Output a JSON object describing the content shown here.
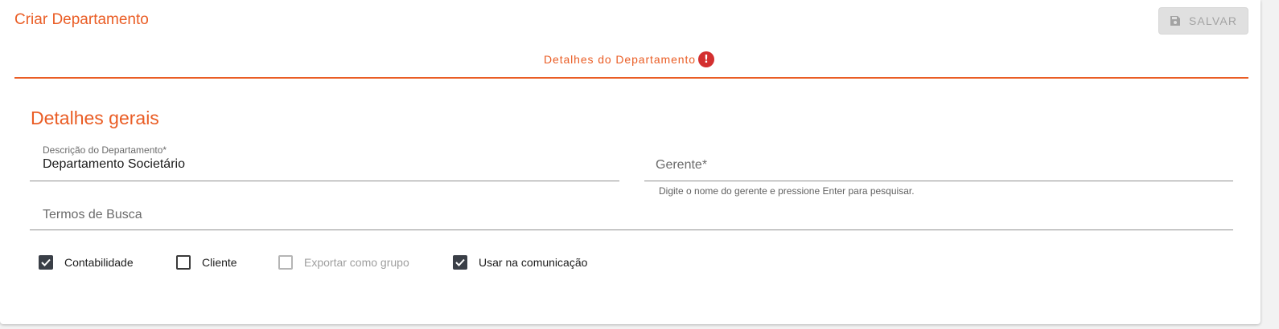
{
  "header": {
    "title": "Criar Departamento",
    "save_label": "SALVAR",
    "save_icon": "save-icon",
    "save_disabled": true
  },
  "tabs": [
    {
      "label": "Detalhes do Departamento",
      "active": true,
      "status_icon": "error-icon",
      "status_glyph": "!"
    }
  ],
  "form": {
    "section_title": "Detalhes gerais",
    "description": {
      "label": "Descrição do Departamento*",
      "value": "Departamento Societário"
    },
    "manager": {
      "label": "Gerente*",
      "value": "",
      "hint": "Digite o nome do gerente e pressione Enter para pesquisar."
    },
    "search_terms": {
      "label": "Termos de Busca",
      "value": ""
    },
    "checkboxes": [
      {
        "label": "Contabilidade",
        "checked": true,
        "disabled": false
      },
      {
        "label": "Cliente",
        "checked": false,
        "disabled": false
      },
      {
        "label": "Exportar como grupo",
        "checked": false,
        "disabled": true
      },
      {
        "label": "Usar na comunicação",
        "checked": true,
        "disabled": false
      }
    ]
  },
  "colors": {
    "accent": "#ea5d25",
    "error": "#d32f2f",
    "checked": "#3a3f47",
    "disabled_button": "#e0e0e0"
  }
}
